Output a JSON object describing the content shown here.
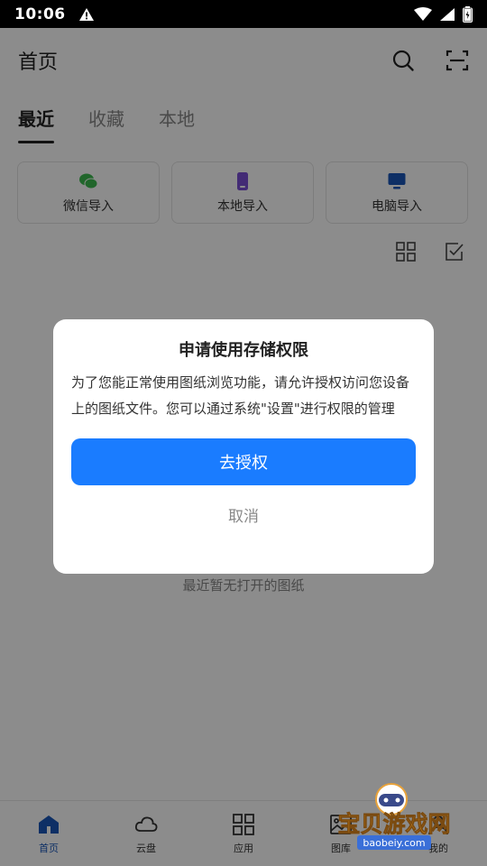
{
  "status_bar": {
    "time": "10:06"
  },
  "header": {
    "title": "首页",
    "search_icon": "search-icon",
    "scan_icon": "scan-icon"
  },
  "tabs": [
    {
      "label": "最近",
      "active": true
    },
    {
      "label": "收藏",
      "active": false
    },
    {
      "label": "本地",
      "active": false
    }
  ],
  "imports": [
    {
      "label": "微信导入",
      "icon": "wechat-icon",
      "color": "#3dbb4f"
    },
    {
      "label": "本地导入",
      "icon": "phone-icon",
      "color": "#7b4fd6"
    },
    {
      "label": "电脑导入",
      "icon": "computer-icon",
      "color": "#1a56b8"
    }
  ],
  "empty_text": "最近暂无打开的图纸",
  "bottom_nav": [
    {
      "label": "首页",
      "icon": "home-icon",
      "active": true
    },
    {
      "label": "云盘",
      "icon": "cloud-icon",
      "active": false
    },
    {
      "label": "应用",
      "icon": "apps-icon",
      "active": false
    },
    {
      "label": "图库",
      "icon": "gallery-icon",
      "active": false
    },
    {
      "label": "我的",
      "icon": "profile-icon",
      "active": false
    }
  ],
  "dialog": {
    "title": "申请使用存储权限",
    "body": "为了您能正常使用图纸浏览功能，请允许授权访问您设备上的图纸文件。您可以通过系统\"设置\"进行权限的管理",
    "confirm_label": "去授权",
    "cancel_label": "取消"
  },
  "watermark": {
    "text": "宝贝游戏网",
    "url_text": "baobeiy.com"
  },
  "colors": {
    "accent": "#1a7cff",
    "nav_active": "#1a56b8"
  }
}
